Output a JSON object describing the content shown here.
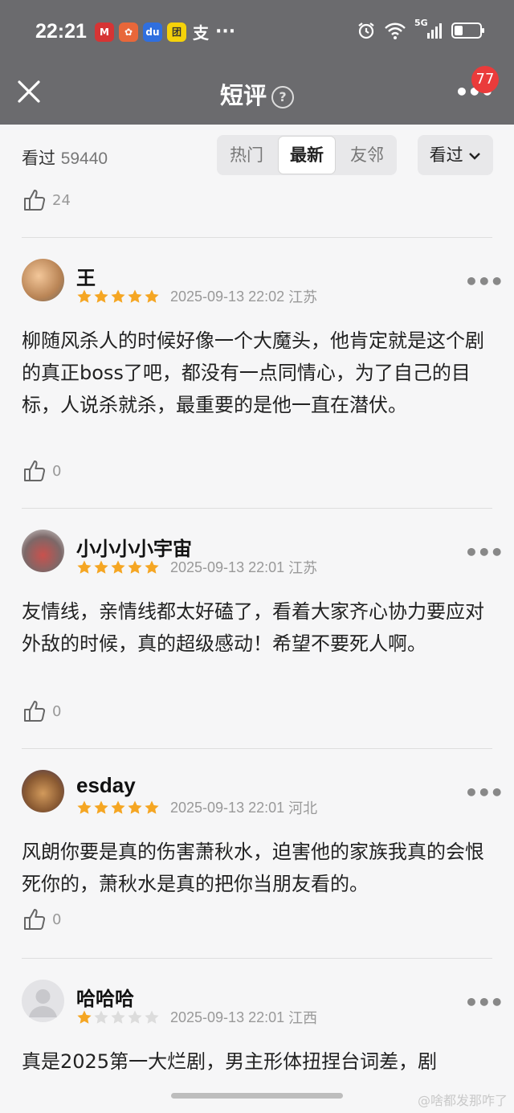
{
  "status_bar": {
    "time": "22:21",
    "app_icons": [
      {
        "name": "cmb-bank-icon",
        "color": "#d63434",
        "glyph": "M"
      },
      {
        "name": "gift-app-icon",
        "color": "#e8673a",
        "glyph": "✿"
      },
      {
        "name": "baidu-icon",
        "color": "#2f6fdf",
        "glyph": "du"
      },
      {
        "name": "meituan-icon",
        "color": "#f5d20a",
        "glyph": "团"
      },
      {
        "name": "alipay-icon",
        "color": "transparent",
        "glyph": "支"
      }
    ],
    "more": "···",
    "network": "5G"
  },
  "nav": {
    "title": "短评",
    "help": "?",
    "badge_count": "77"
  },
  "filter": {
    "seen_label": "看过",
    "seen_count": "59440",
    "tabs": [
      "热门",
      "最新",
      "友邻"
    ],
    "active_tab": 1,
    "sort_label": "看过"
  },
  "prev_like_count": "24",
  "reviews": [
    {
      "username": "王",
      "rating": 5,
      "datetime": "2025-09-13 22:02",
      "location": "江苏",
      "text": "柳随风杀人的时候好像一个大魔头，他肯定就是这个剧的真正boss了吧，都没有一点同情心，为了自己的目标，人说杀就杀，最重要的是他一直在潜伏。",
      "likes": "0"
    },
    {
      "username": "小小小小宇宙",
      "rating": 5,
      "datetime": "2025-09-13 22:01",
      "location": "江苏",
      "text": "友情线，亲情线都太好磕了，看着大家齐心协力要应对外敌的时候，真的超级感动！希望不要死人啊。",
      "likes": "0"
    },
    {
      "username": "esday",
      "rating": 5,
      "datetime": "2025-09-13 22:01",
      "location": "河北",
      "text": "风朗你要是真的伤害萧秋水，迫害他的家族我真的会恨死你的，萧秋水是真的把你当朋友看的。",
      "likes": "0"
    },
    {
      "username": "哈哈哈",
      "rating": 1,
      "datetime": "2025-09-13 22:01",
      "location": "江西",
      "text": "真是2025第一大烂剧，男主形体扭捏台词差，剧",
      "likes": ""
    }
  ],
  "watermark": "@啥都发那咋了",
  "colors": {
    "star_on": "#f5a623",
    "star_off": "#dcdcdc",
    "badge": "#ea3b3b",
    "header": "#6b6b6e"
  }
}
